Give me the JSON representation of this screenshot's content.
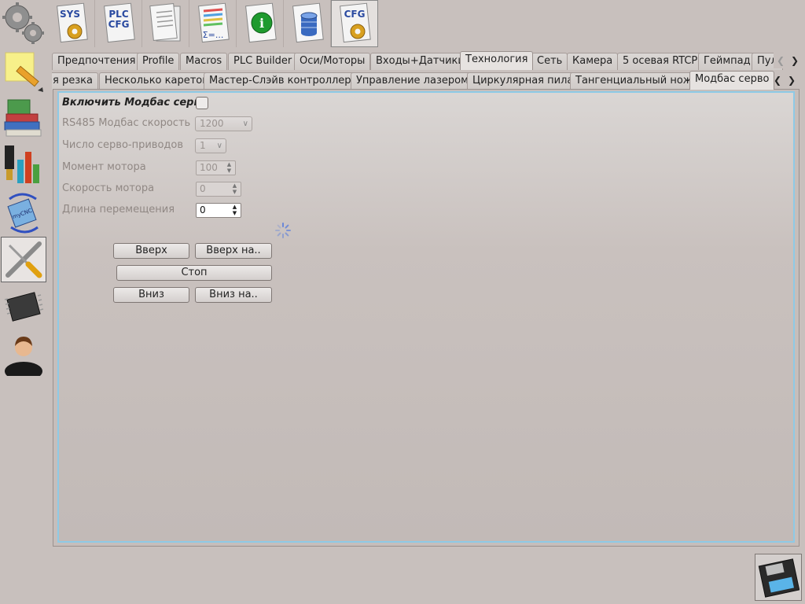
{
  "toolbar": {
    "items": [
      {
        "name": "sys-config",
        "label": "SYS"
      },
      {
        "name": "plc-config",
        "label": "PLC\nCFG"
      },
      {
        "name": "documents",
        "label": ""
      },
      {
        "name": "formula-table",
        "label": "Σ=..."
      },
      {
        "name": "info",
        "label": "i"
      },
      {
        "name": "database",
        "label": ""
      },
      {
        "name": "cfg-config",
        "label": "CFG"
      }
    ]
  },
  "sidebar": {
    "items": [
      {
        "name": "settings"
      },
      {
        "name": "edit"
      },
      {
        "name": "books"
      },
      {
        "name": "charts"
      },
      {
        "name": "mycnc-rotate",
        "label": "myCNC"
      },
      {
        "name": "tools"
      },
      {
        "name": "chip"
      },
      {
        "name": "user"
      }
    ]
  },
  "tabs_row1": [
    "Предпочтения",
    "Profile",
    "Macros",
    "PLC Builder",
    "Оси/Моторы",
    "Входы+Датчики",
    "Технология",
    "Сеть",
    "Камера",
    "5 осевая RTCP",
    "Геймпад",
    "Пул"
  ],
  "tabs_row1_active": "Технология",
  "tabs_row2": [
    "я резка",
    "Несколько кареток",
    "Мастер-Слэйв контроллеры",
    "Управление лазером",
    "Циркулярная пила",
    "Тангенциальный нож",
    "Модбас серво"
  ],
  "tabs_row2_active": "Модбас серво",
  "form": {
    "enable_label": "Включить Модбас серво",
    "enable_checked": false,
    "baud_label": "RS485 Модбас скорость",
    "baud_value": "1200",
    "servo_count_label": "Число серво-приводов",
    "servo_count_value": "1",
    "torque_label": "Момент мотора",
    "torque_value": "100",
    "speed_label": "Скорость мотора",
    "speed_value": "0",
    "move_length_label": "Длина перемещения",
    "move_length_value": "0"
  },
  "buttons": {
    "up": "Вверх",
    "up_by": "Вверх на..",
    "stop": "Стоп",
    "down": "Вниз",
    "down_by": "Вниз на.."
  },
  "colors": {
    "background": "#c8c0bd",
    "frame_border": "#8ecae6"
  }
}
